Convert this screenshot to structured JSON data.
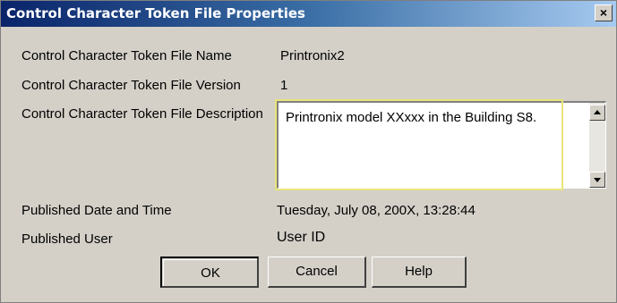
{
  "window": {
    "title": "Control Character Token File Properties",
    "close_label": "×"
  },
  "fields": {
    "name_label": "Control Character Token File Name",
    "name_value": "Printronix2",
    "version_label": "Control Character Token File Version",
    "version_value": "1",
    "description_label": "Control Character Token File Description",
    "description_value": "Printronix model XXxxx in the Building S8.",
    "published_date_label": "Published Date and Time",
    "published_date_value": "Tuesday, July 08, 200X, 13:28:44",
    "published_user_label": "Published User",
    "published_user_value": "User ID"
  },
  "buttons": {
    "ok": "OK",
    "cancel": "Cancel",
    "help": "Help"
  },
  "colors": {
    "titlebar_start": "#0a246a",
    "titlebar_end": "#a6caf0",
    "dialog_bg": "#d4d0c8",
    "highlight": "#e8e47a"
  }
}
